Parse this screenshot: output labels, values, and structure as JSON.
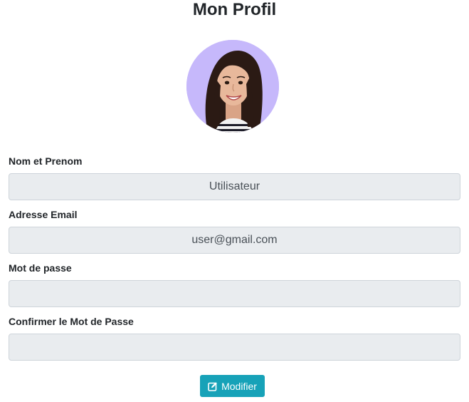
{
  "page": {
    "title": "Mon Profil"
  },
  "avatar": {
    "icon": "user-photo",
    "background_color": "#c6b8fb"
  },
  "form": {
    "name": {
      "label": "Nom et Prenom",
      "value": "Utilisateur"
    },
    "email": {
      "label": "Adresse Email",
      "value": "user@gmail.com"
    },
    "password": {
      "label": "Mot de passe",
      "value": ""
    },
    "confirm_password": {
      "label": "Confirmer le Mot de Passe",
      "value": ""
    }
  },
  "actions": {
    "modify_label": "Modifier",
    "modify_icon": "edit-icon",
    "button_color": "#17a2b8"
  }
}
